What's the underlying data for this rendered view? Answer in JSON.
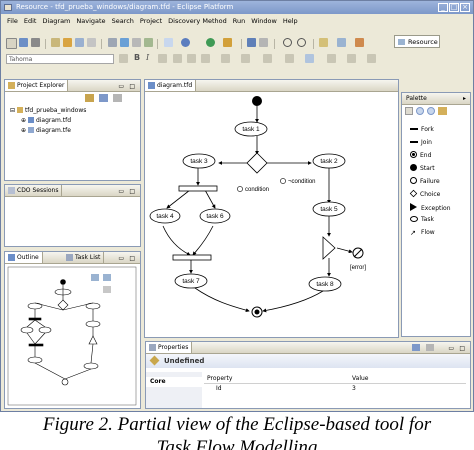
{
  "window": {
    "title": "Resource - tfd_prueba_windows/diagram.tfd - Eclipse Platform"
  },
  "menu": [
    "File",
    "Edit",
    "Diagram",
    "Navigate",
    "Search",
    "Project",
    "Discovery Method",
    "Run",
    "Window",
    "Help"
  ],
  "toolbar": {
    "font_name": "Tahoma",
    "perspective_label": "Resource"
  },
  "project_explorer": {
    "tab_label": "Project Explorer",
    "items": [
      "tfd_prueba_windows",
      "diagram.tfd",
      "diagram.tfe"
    ]
  },
  "cdo": {
    "tab_label": "CDO Sessions"
  },
  "outline": {
    "tab_label": "Outline",
    "task_tab_label": "Task List"
  },
  "editor": {
    "tab_label": "diagram.tfd",
    "nodes": {
      "task1": "task 1",
      "task2": "task 2",
      "task3": "task 3",
      "task4": "task 4",
      "task5": "task 5",
      "task6": "task 6",
      "task7": "task 7",
      "task8": "task 8"
    },
    "labels": {
      "condition": "condition",
      "not_condition": "¬condition",
      "error": "[error]"
    }
  },
  "palette": {
    "title": "Palette",
    "items": [
      "Fork",
      "Join",
      "End",
      "Start",
      "Failure",
      "Choice",
      "Exception",
      "Task",
      "Flow"
    ]
  },
  "properties": {
    "tab_label": "Properties",
    "header": "Undefined",
    "section": "Core",
    "col_property": "Property",
    "col_value": "Value",
    "row_property": "Id",
    "row_value": "3"
  },
  "caption": {
    "line1": "Figure 2. Partial view of the Eclipse-based tool for",
    "line2": "Task Flow Modelling"
  },
  "colors": {
    "titlebar": "#7d98c9",
    "chrome": "#ece9d8",
    "panel_border": "#8a9ab5"
  }
}
